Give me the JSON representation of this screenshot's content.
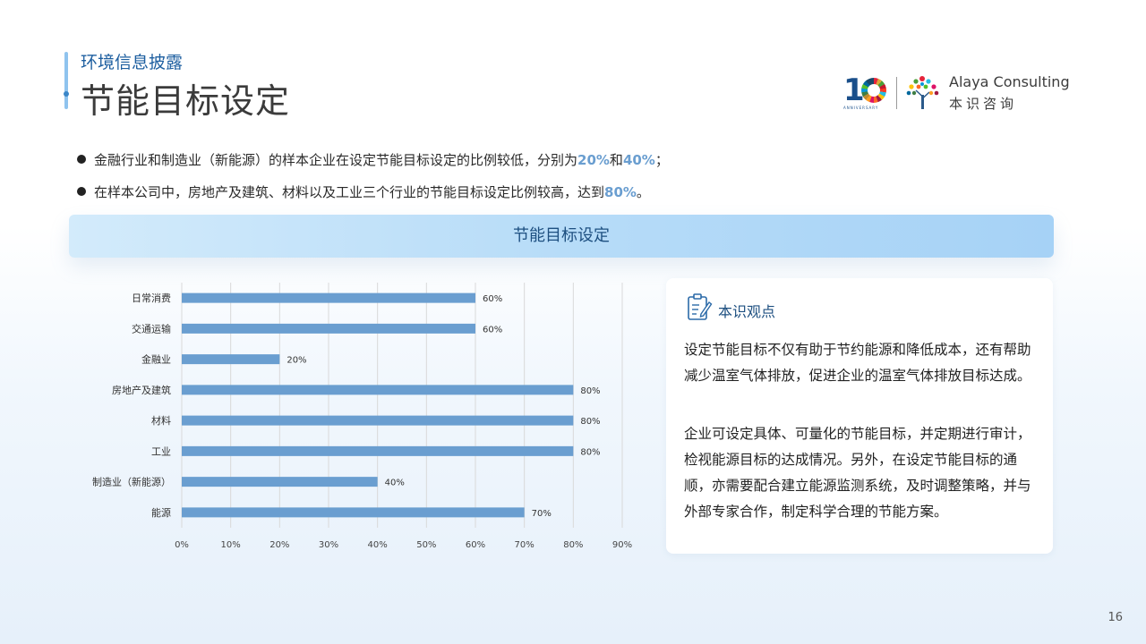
{
  "header": {
    "section_label": "环境信息披露",
    "page_title": "节能目标设定"
  },
  "logo": {
    "anniversary_number": "10",
    "anniversary_text": "ANNIVERSARY",
    "brand_en": "Alaya Consulting",
    "brand_cn": "本识咨询"
  },
  "bullets": [
    {
      "parts": [
        "金融行业和制造业（新能源）的样本企业在设定节能目标设定的比例较低，分别为",
        "20%",
        "和",
        "40%",
        "；"
      ]
    },
    {
      "parts": [
        "在样本公司中，房地产及建筑、材料以及工业三个行业的节能目标设定比例较高，达到",
        "80%",
        "。"
      ]
    }
  ],
  "banner": {
    "title": "节能目标设定"
  },
  "chart_data": {
    "type": "bar",
    "orientation": "horizontal",
    "categories": [
      "日常消费",
      "交通运输",
      "金融业",
      "房地产及建筑",
      "材料",
      "工业",
      "制造业（新能源）",
      "能源"
    ],
    "values": [
      60,
      60,
      20,
      80,
      80,
      80,
      40,
      70
    ],
    "data_labels": [
      "60%",
      "60%",
      "20%",
      "80%",
      "80%",
      "80%",
      "40%",
      "70%"
    ],
    "x_ticks": [
      "0%",
      "10%",
      "20%",
      "30%",
      "40%",
      "50%",
      "60%",
      "70%",
      "80%",
      "90%"
    ],
    "xlim": [
      0,
      90
    ],
    "grid": true,
    "bar_color": "#6a9ed0",
    "grid_color": "#d9d9d9"
  },
  "insight": {
    "title": "本识观点",
    "paragraph1": "设定节能目标不仅有助于节约能源和降低成本，还有帮助减少温室气体排放，促进企业的温室气体排放目标达成。",
    "paragraph2": "企业可设定具体、可量化的节能目标，并定期进行审计，检视能源目标的达成情况。另外，在设定节能目标的通顺，亦需要配合建立能源监测系统，及时调整策略，并与外部专家合作，制定科学合理的节能方案。"
  },
  "page_number": "16",
  "colors": {
    "accent": "#1e5fa0",
    "highlight": "#6a9ed0",
    "banner_start": "#d3ebfb",
    "banner_end": "#a6d2f6"
  }
}
